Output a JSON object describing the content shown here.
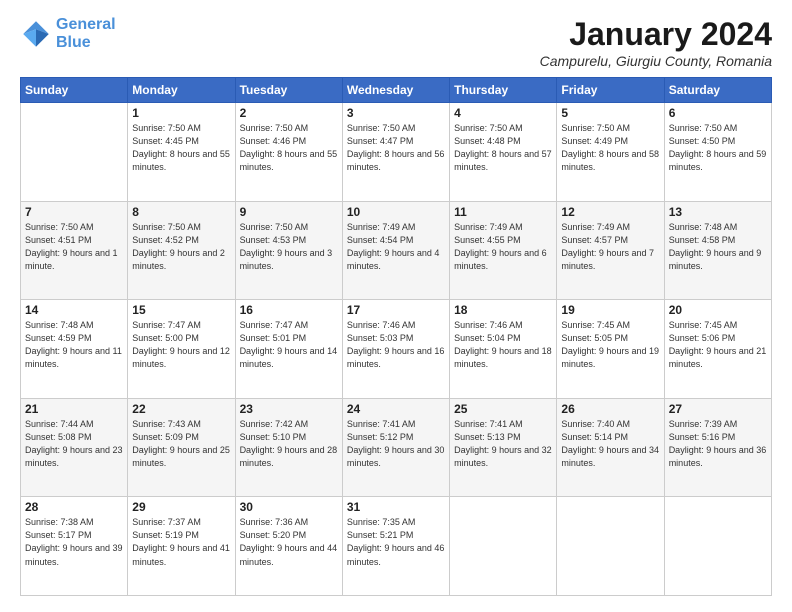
{
  "logo": {
    "line1": "General",
    "line2": "Blue"
  },
  "title": "January 2024",
  "location": "Campurelu, Giurgiu County, Romania",
  "headers": [
    "Sunday",
    "Monday",
    "Tuesday",
    "Wednesday",
    "Thursday",
    "Friday",
    "Saturday"
  ],
  "weeks": [
    [
      {
        "day": "",
        "info": ""
      },
      {
        "day": "1",
        "info": "Sunrise: 7:50 AM\nSunset: 4:45 PM\nDaylight: 8 hours\nand 55 minutes."
      },
      {
        "day": "2",
        "info": "Sunrise: 7:50 AM\nSunset: 4:46 PM\nDaylight: 8 hours\nand 55 minutes."
      },
      {
        "day": "3",
        "info": "Sunrise: 7:50 AM\nSunset: 4:47 PM\nDaylight: 8 hours\nand 56 minutes."
      },
      {
        "day": "4",
        "info": "Sunrise: 7:50 AM\nSunset: 4:48 PM\nDaylight: 8 hours\nand 57 minutes."
      },
      {
        "day": "5",
        "info": "Sunrise: 7:50 AM\nSunset: 4:49 PM\nDaylight: 8 hours\nand 58 minutes."
      },
      {
        "day": "6",
        "info": "Sunrise: 7:50 AM\nSunset: 4:50 PM\nDaylight: 8 hours\nand 59 minutes."
      }
    ],
    [
      {
        "day": "7",
        "info": "Sunrise: 7:50 AM\nSunset: 4:51 PM\nDaylight: 9 hours\nand 1 minute."
      },
      {
        "day": "8",
        "info": "Sunrise: 7:50 AM\nSunset: 4:52 PM\nDaylight: 9 hours\nand 2 minutes."
      },
      {
        "day": "9",
        "info": "Sunrise: 7:50 AM\nSunset: 4:53 PM\nDaylight: 9 hours\nand 3 minutes."
      },
      {
        "day": "10",
        "info": "Sunrise: 7:49 AM\nSunset: 4:54 PM\nDaylight: 9 hours\nand 4 minutes."
      },
      {
        "day": "11",
        "info": "Sunrise: 7:49 AM\nSunset: 4:55 PM\nDaylight: 9 hours\nand 6 minutes."
      },
      {
        "day": "12",
        "info": "Sunrise: 7:49 AM\nSunset: 4:57 PM\nDaylight: 9 hours\nand 7 minutes."
      },
      {
        "day": "13",
        "info": "Sunrise: 7:48 AM\nSunset: 4:58 PM\nDaylight: 9 hours\nand 9 minutes."
      }
    ],
    [
      {
        "day": "14",
        "info": "Sunrise: 7:48 AM\nSunset: 4:59 PM\nDaylight: 9 hours\nand 11 minutes."
      },
      {
        "day": "15",
        "info": "Sunrise: 7:47 AM\nSunset: 5:00 PM\nDaylight: 9 hours\nand 12 minutes."
      },
      {
        "day": "16",
        "info": "Sunrise: 7:47 AM\nSunset: 5:01 PM\nDaylight: 9 hours\nand 14 minutes."
      },
      {
        "day": "17",
        "info": "Sunrise: 7:46 AM\nSunset: 5:03 PM\nDaylight: 9 hours\nand 16 minutes."
      },
      {
        "day": "18",
        "info": "Sunrise: 7:46 AM\nSunset: 5:04 PM\nDaylight: 9 hours\nand 18 minutes."
      },
      {
        "day": "19",
        "info": "Sunrise: 7:45 AM\nSunset: 5:05 PM\nDaylight: 9 hours\nand 19 minutes."
      },
      {
        "day": "20",
        "info": "Sunrise: 7:45 AM\nSunset: 5:06 PM\nDaylight: 9 hours\nand 21 minutes."
      }
    ],
    [
      {
        "day": "21",
        "info": "Sunrise: 7:44 AM\nSunset: 5:08 PM\nDaylight: 9 hours\nand 23 minutes."
      },
      {
        "day": "22",
        "info": "Sunrise: 7:43 AM\nSunset: 5:09 PM\nDaylight: 9 hours\nand 25 minutes."
      },
      {
        "day": "23",
        "info": "Sunrise: 7:42 AM\nSunset: 5:10 PM\nDaylight: 9 hours\nand 28 minutes."
      },
      {
        "day": "24",
        "info": "Sunrise: 7:41 AM\nSunset: 5:12 PM\nDaylight: 9 hours\nand 30 minutes."
      },
      {
        "day": "25",
        "info": "Sunrise: 7:41 AM\nSunset: 5:13 PM\nDaylight: 9 hours\nand 32 minutes."
      },
      {
        "day": "26",
        "info": "Sunrise: 7:40 AM\nSunset: 5:14 PM\nDaylight: 9 hours\nand 34 minutes."
      },
      {
        "day": "27",
        "info": "Sunrise: 7:39 AM\nSunset: 5:16 PM\nDaylight: 9 hours\nand 36 minutes."
      }
    ],
    [
      {
        "day": "28",
        "info": "Sunrise: 7:38 AM\nSunset: 5:17 PM\nDaylight: 9 hours\nand 39 minutes."
      },
      {
        "day": "29",
        "info": "Sunrise: 7:37 AM\nSunset: 5:19 PM\nDaylight: 9 hours\nand 41 minutes."
      },
      {
        "day": "30",
        "info": "Sunrise: 7:36 AM\nSunset: 5:20 PM\nDaylight: 9 hours\nand 44 minutes."
      },
      {
        "day": "31",
        "info": "Sunrise: 7:35 AM\nSunset: 5:21 PM\nDaylight: 9 hours\nand 46 minutes."
      },
      {
        "day": "",
        "info": ""
      },
      {
        "day": "",
        "info": ""
      },
      {
        "day": "",
        "info": ""
      }
    ]
  ]
}
